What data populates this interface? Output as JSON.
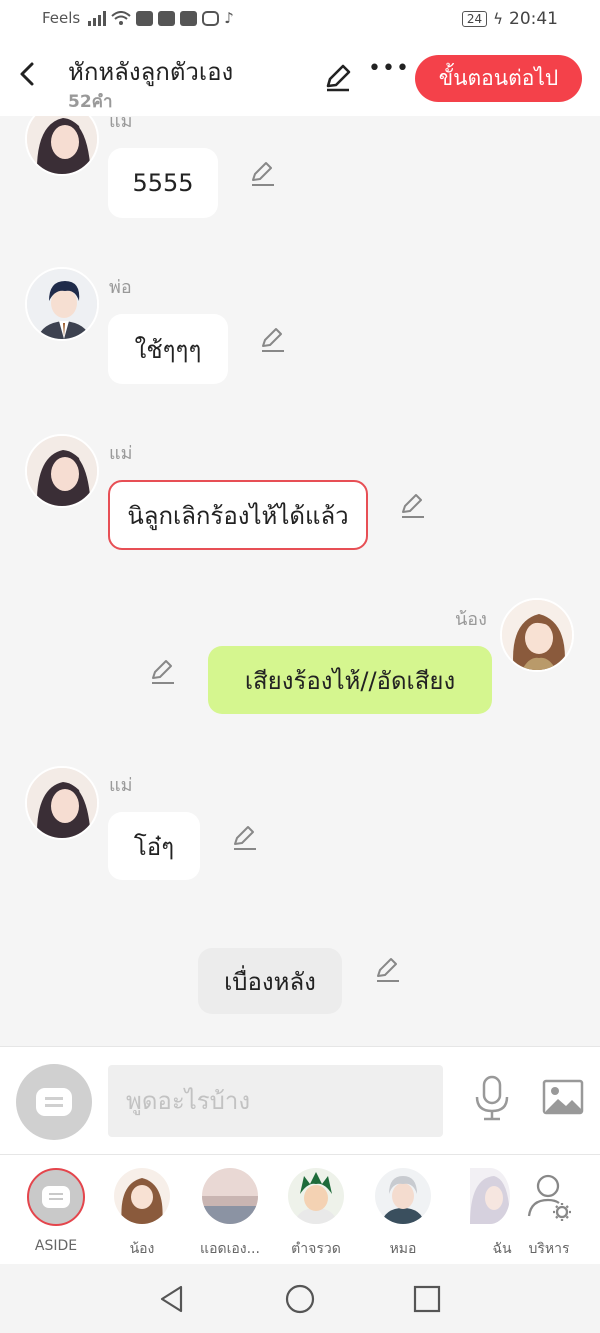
{
  "status_bar": {
    "carrier": "Feels",
    "battery": "24",
    "time": "20:41"
  },
  "header": {
    "title": "หักหลังลูกตัวเอง",
    "word_count": "52คำ",
    "next_label": "ขั้นตอนต่อไป"
  },
  "messages": [
    {
      "sender": "แม่",
      "text": "5555"
    },
    {
      "sender": "พ่อ",
      "text": "ใช้ๆๆๆ"
    },
    {
      "sender": "แม่",
      "text": "นิลูกเลิกร้องไห้ได้แล้ว"
    },
    {
      "sender": "น้อง",
      "text": "เสียงร้องไห้//อัดเสียง"
    },
    {
      "sender": "แม่",
      "text": "โอ๋ๆ"
    },
    {
      "sender": "",
      "text": "เบื่องหลัง"
    }
  ],
  "input": {
    "placeholder": "พูดอะไรบ้าง"
  },
  "characters": [
    {
      "label": "ASIDE"
    },
    {
      "label": "น้อง"
    },
    {
      "label": "แอดเอง..."
    },
    {
      "label": "ตำจรวด"
    },
    {
      "label": "หมอ"
    },
    {
      "label": "ฉัน"
    },
    {
      "label": "บริหาร"
    }
  ],
  "colors": {
    "accent": "#f4414a",
    "self_bubble": "#d5f68f",
    "selected_border": "#e74f55"
  }
}
